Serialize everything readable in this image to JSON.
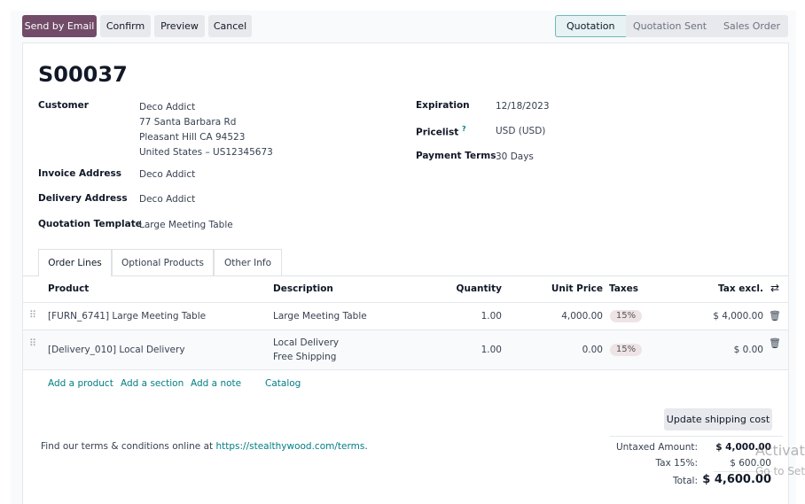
{
  "buttons": {
    "send_email": "Send by Email",
    "confirm": "Confirm",
    "preview": "Preview",
    "cancel": "Cancel"
  },
  "status_steps": [
    "Quotation",
    "Quotation Sent",
    "Sales Order"
  ],
  "title": "S00037",
  "fields": {
    "customer_label": "Customer",
    "customer_lines": [
      "Deco Addict",
      "77 Santa Barbara Rd",
      "Pleasant Hill CA 94523",
      "United States – US12345673"
    ],
    "invoice_label": "Invoice Address",
    "invoice_value": "Deco Addict",
    "delivery_label": "Delivery Address",
    "delivery_value": "Deco Addict",
    "template_label": "Quotation Template",
    "template_value": "Large Meeting Table",
    "expiration_label": "Expiration",
    "expiration_value": "12/18/2023",
    "pricelist_label": "Pricelist",
    "pricelist_help": "?",
    "pricelist_value": "USD (USD)",
    "payment_label": "Payment Terms",
    "payment_value": "30 Days"
  },
  "tabs": [
    "Order Lines",
    "Optional Products",
    "Other Info"
  ],
  "table": {
    "headers": {
      "product": "Product",
      "description": "Description",
      "quantity": "Quantity",
      "unit_price": "Unit Price",
      "taxes": "Taxes",
      "tax_excl": "Tax excl."
    },
    "rows": [
      {
        "product": "[FURN_6741] Large Meeting Table",
        "description": [
          "Large Meeting Table"
        ],
        "quantity": "1.00",
        "unit_price": "4,000.00",
        "taxes": "15%",
        "tax_excl": "$ 4,000.00"
      },
      {
        "product": "[Delivery_010] Local Delivery",
        "description": [
          "Local Delivery",
          "Free Shipping"
        ],
        "quantity": "1.00",
        "unit_price": "0.00",
        "taxes": "15%",
        "tax_excl": "$ 0.00"
      }
    ]
  },
  "actions": {
    "add_product": "Add a product",
    "add_section": "Add a section",
    "add_note": "Add a note",
    "catalog": "Catalog"
  },
  "update_shipping": "Update shipping cost",
  "terms_text": "Find our terms & conditions online at ",
  "terms_link": "https://stealthywood.com/terms",
  "terms_end": ".",
  "totals": {
    "untaxed_label": "Untaxed Amount:",
    "untaxed_value": "$ 4,000.00",
    "tax_label": "Tax 15%:",
    "tax_value": "$ 600.00",
    "total_label": "Total:",
    "total_value": "$ 4,600.00"
  },
  "watermark": [
    "Activate Windows",
    "Go to Settings to activate Windows."
  ]
}
